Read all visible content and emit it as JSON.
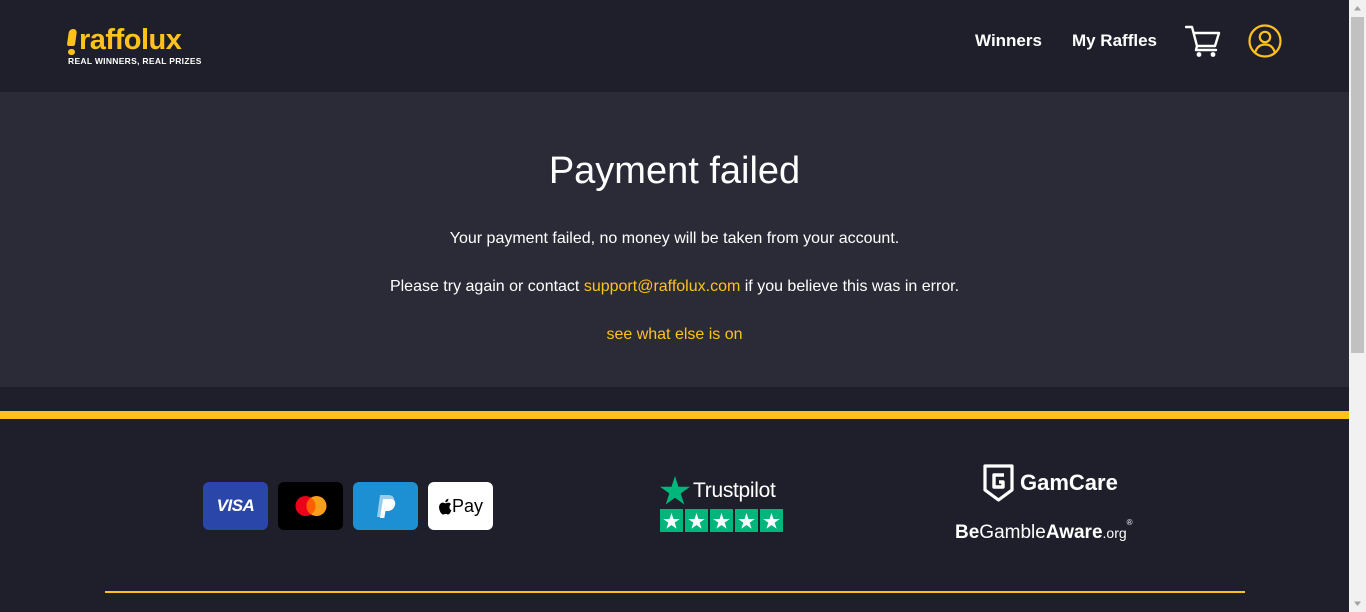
{
  "header": {
    "logo_text": "raffolux",
    "logo_tagline": "REAL WINNERS, REAL PRIZES",
    "nav": [
      {
        "label": "Winners"
      },
      {
        "label": "My Raffles"
      }
    ],
    "icons": [
      "cart-icon",
      "user-account-icon"
    ]
  },
  "main": {
    "title": "Payment failed",
    "message_1": "Your payment failed, no money will be taken from your account.",
    "message_2_before": "Please try again or contact ",
    "support_email": "support@raffolux.com",
    "message_2_after": " if you believe this was in error.",
    "more_link": "see what else is on"
  },
  "footer": {
    "payment_methods": {
      "visa": "VISA",
      "apple_pay": "Pay"
    },
    "trustpilot": {
      "label": "Trustpilot",
      "stars": 5
    },
    "gamcare": {
      "label": "GamCare"
    },
    "begambleaware": {
      "be": "Be",
      "gamble": "Gamble",
      "aware": "Aware",
      "org": ".org",
      "reg": "®"
    }
  },
  "colors": {
    "accent": "#ffc21a",
    "background": "#1f1f2b",
    "panel": "#2b2b37",
    "trustpilot_green": "#00b67a"
  }
}
